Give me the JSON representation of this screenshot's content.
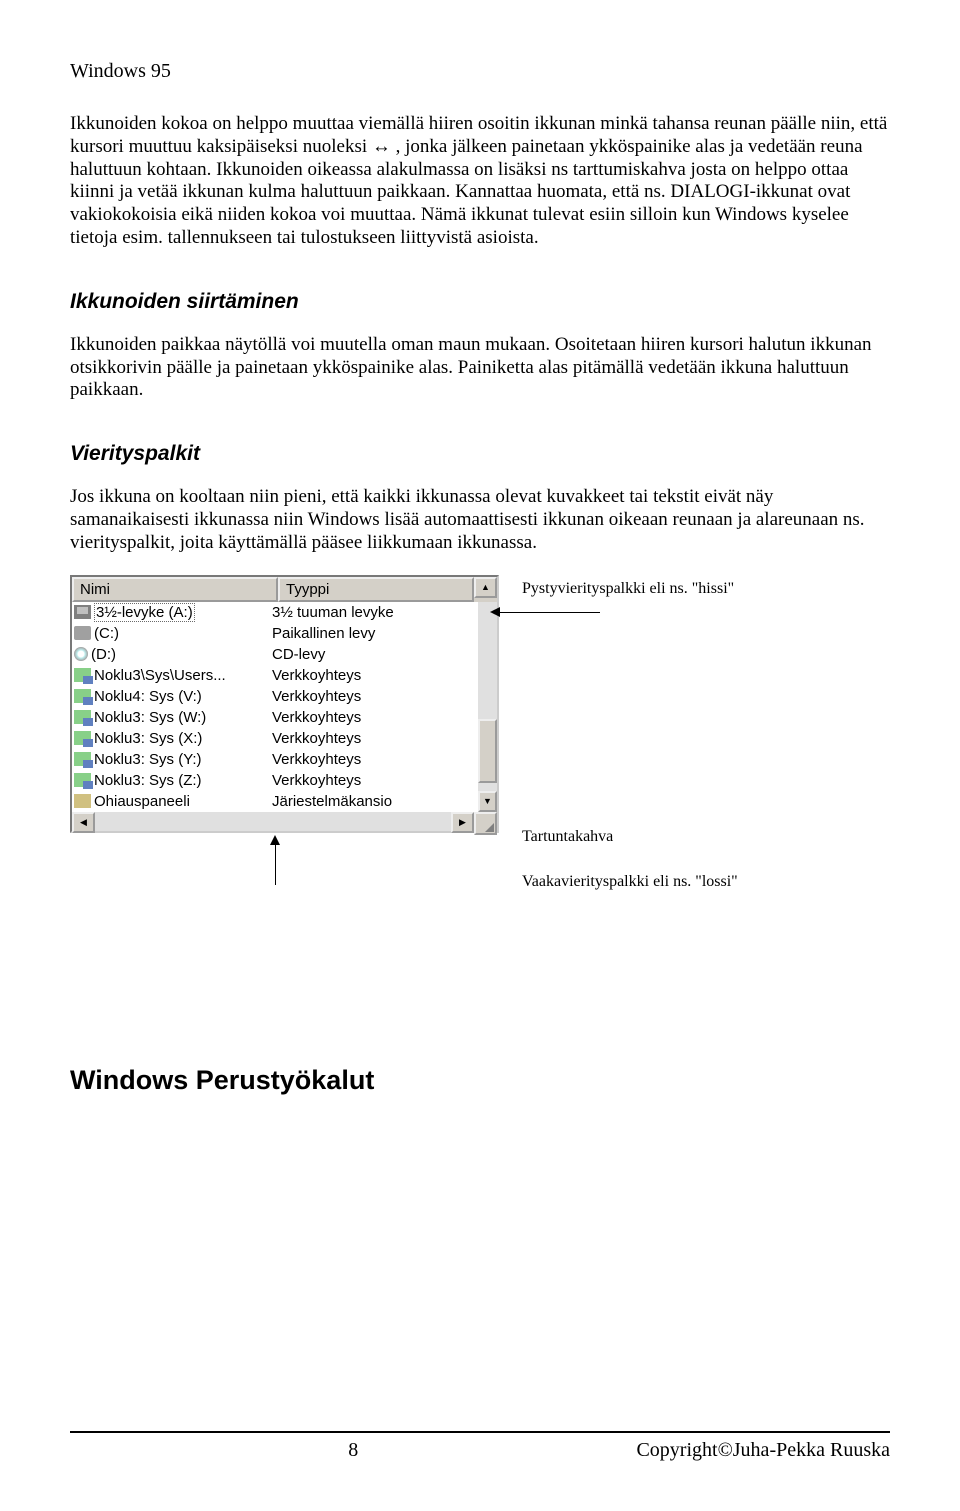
{
  "header": {
    "title": "Windows 95"
  },
  "paragraphs": {
    "p1": "Ikkunoiden kokoa on helppo muuttaa viemällä hiiren osoitin ikkunan minkä tahansa reunan päälle niin, että kursori muuttuu kaksipäiseksi nuoleksi ↔ , jonka jälkeen painetaan ykköspainike alas ja vedetään reuna haluttuun kohtaan. Ikkunoiden oikeassa alakulmassa on lisäksi ns tarttumiskahva josta on helppo ottaa kiinni ja vetää ikkunan kulma haluttuun paikkaan. Kannattaa huomata, että ns. DIALOGI-ikkunat ovat vakiokokoisia eikä niiden kokoa voi muuttaa. Nämä ikkunat tulevat esiin silloin kun Windows kyselee tietoja esim. tallennukseen tai tulostukseen liittyvistä asioista.",
    "p2": "Ikkunoiden paikkaa näytöllä voi muutella oman maun mukaan. Osoitetaan hiiren kursori halutun ikkunan otsikkorivin päälle ja painetaan ykköspainike alas. Painiketta alas pitämällä vedetään ikkuna haluttuun paikkaan.",
    "p3": "Jos ikkuna on kooltaan niin pieni, että kaikki ikkunassa olevat kuvakkeet tai tekstit eivät näy samanaikaisesti ikkunassa niin Windows lisää automaattisesti ikkunan oikeaan reunaan ja alareunaan ns. vierityspalkit, joita käyttämällä pääsee liikkumaan ikkunassa."
  },
  "headings": {
    "h2a": "Ikkunoiden siirtäminen",
    "h2b": "Vierityspalkit",
    "h1a": "Windows Perustyökalut"
  },
  "listview": {
    "col_name": "Nimi",
    "col_type": "Tyyppi",
    "rows": [
      {
        "name": "3½-levyke (A:)",
        "type": "3½ tuuman levyke",
        "icon": "floppy",
        "selected": true
      },
      {
        "name": "(C:)",
        "type": "Paikallinen levy",
        "icon": "hdd"
      },
      {
        "name": "(D:)",
        "type": "CD-levy",
        "icon": "cd"
      },
      {
        "name": "Noklu3\\Sys\\Users...",
        "type": "Verkkoyhteys",
        "icon": "net"
      },
      {
        "name": "Noklu4: Sys (V:)",
        "type": "Verkkoyhteys",
        "icon": "net"
      },
      {
        "name": "Noklu3: Sys (W:)",
        "type": "Verkkoyhteys",
        "icon": "net"
      },
      {
        "name": "Noklu3: Sys (X:)",
        "type": "Verkkoyhteys",
        "icon": "net"
      },
      {
        "name": "Noklu3: Sys (Y:)",
        "type": "Verkkoyhteys",
        "icon": "net"
      },
      {
        "name": "Noklu3: Sys (Z:)",
        "type": "Verkkoyhteys",
        "icon": "net"
      },
      {
        "name": "Ohiauspaneeli",
        "type": "Järiestelmäkansio",
        "icon": "panel"
      }
    ]
  },
  "callouts": {
    "vscroll": "Pystyvierityspalkki eli ns. \"hissi\"",
    "grip": "Tartuntakahva",
    "hscroll": "Vaakavierityspalkki eli ns. \"lossi\""
  },
  "footer": {
    "page": "8",
    "copyright": "Copyright©Juha-Pekka Ruuska"
  }
}
